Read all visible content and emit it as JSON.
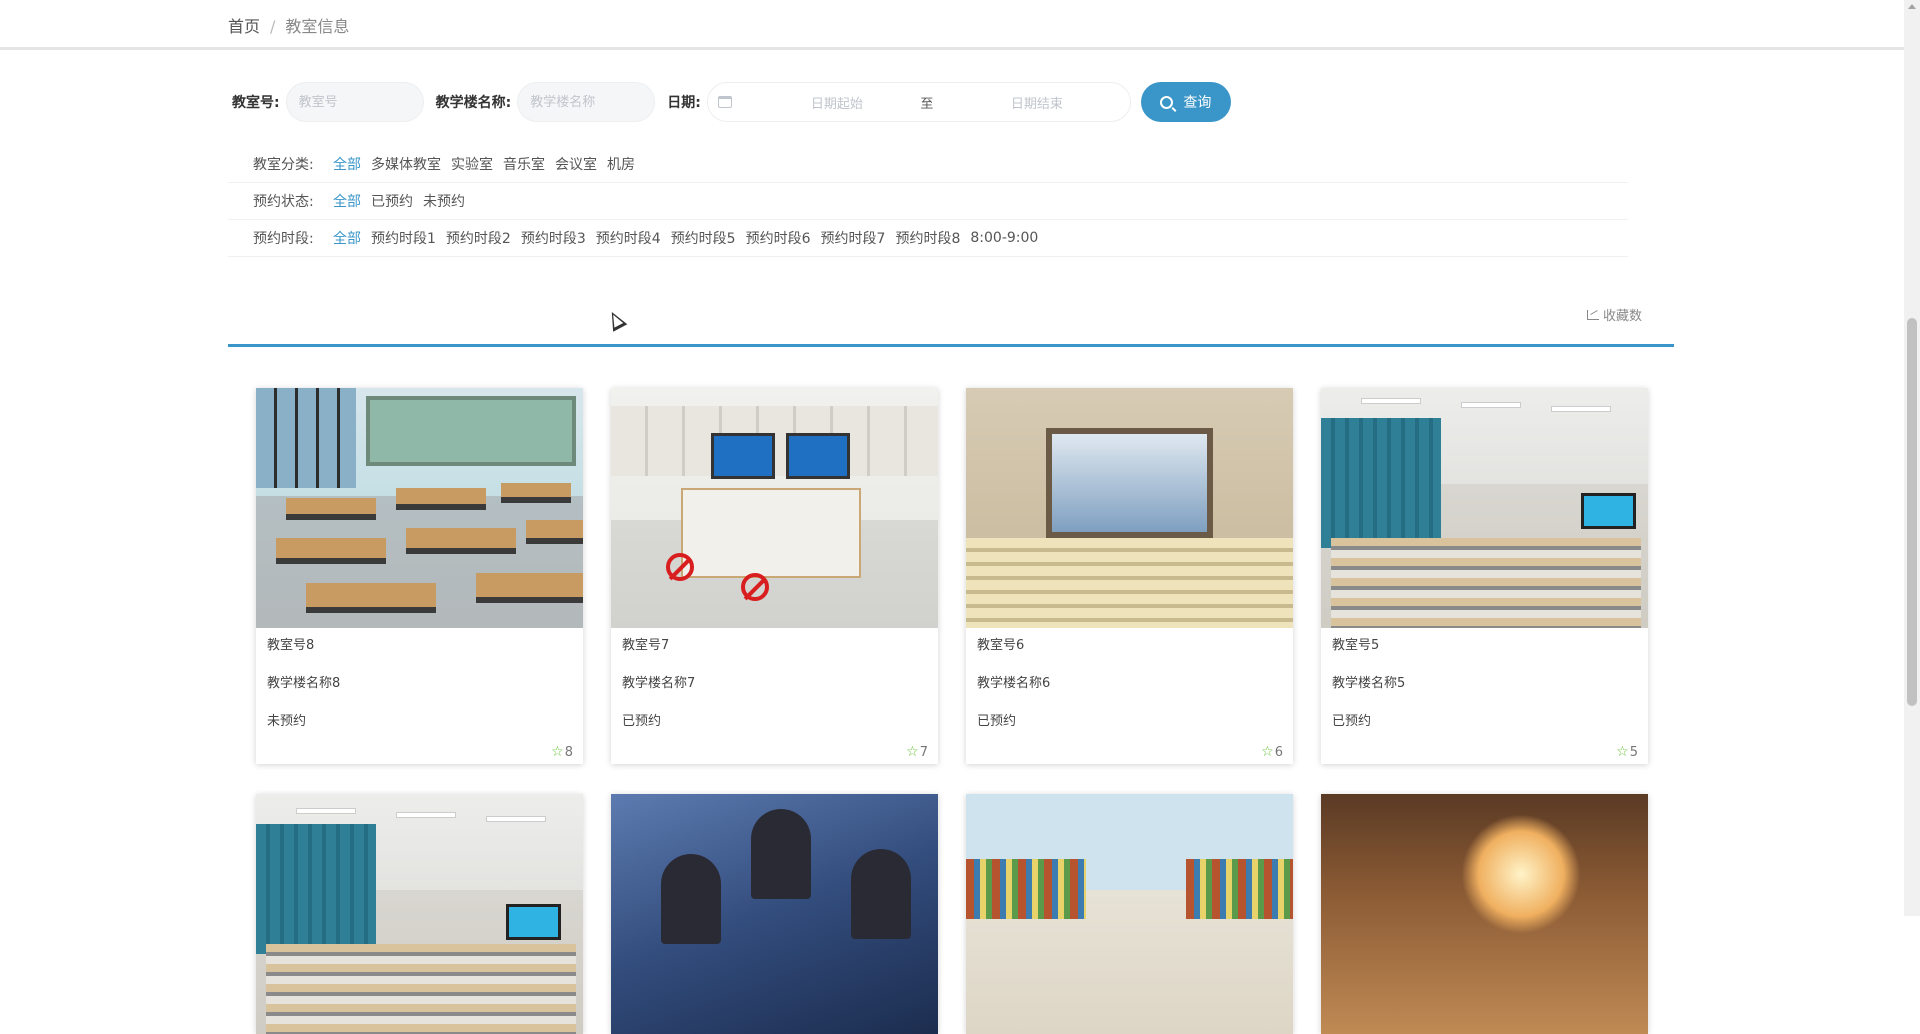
{
  "breadcrumb": {
    "home": "首页",
    "separator": "/",
    "current": "教室信息"
  },
  "search": {
    "classroom_label": "教室号:",
    "classroom_placeholder": "教室号",
    "building_label": "教学楼名称:",
    "building_placeholder": "教学楼名称",
    "date_label": "日期:",
    "date_start_placeholder": "日期起始",
    "date_separator": "至",
    "date_end_placeholder": "日期结束",
    "query_label": "查询"
  },
  "filters": [
    {
      "title": "教室分类:",
      "options": [
        "全部",
        "多媒体教室",
        "实验室",
        "音乐室",
        "会议室",
        "机房"
      ],
      "active": 0
    },
    {
      "title": "预约状态:",
      "options": [
        "全部",
        "已预约",
        "未预约"
      ],
      "active": 0
    },
    {
      "title": "预约时段:",
      "options": [
        "全部",
        "预约时段1",
        "预约时段2",
        "预约时段3",
        "预约时段4",
        "预约时段5",
        "预约时段6",
        "预约时段7",
        "预约时段8",
        "8:00-9:00"
      ],
      "active": 0
    }
  ],
  "sort": {
    "favorites_label": "收藏数"
  },
  "colors": {
    "accent": "#3a96c9",
    "star": "#67c23a"
  },
  "cards": [
    {
      "classroom": "教室号8",
      "building": "教学楼名称8",
      "status": "未预约",
      "favorites": "8"
    },
    {
      "classroom": "教室号7",
      "building": "教学楼名称7",
      "status": "已预约",
      "favorites": "7"
    },
    {
      "classroom": "教室号6",
      "building": "教学楼名称6",
      "status": "已预约",
      "favorites": "6"
    },
    {
      "classroom": "教室号5",
      "building": "教学楼名称5",
      "status": "已预约",
      "favorites": "5"
    }
  ]
}
